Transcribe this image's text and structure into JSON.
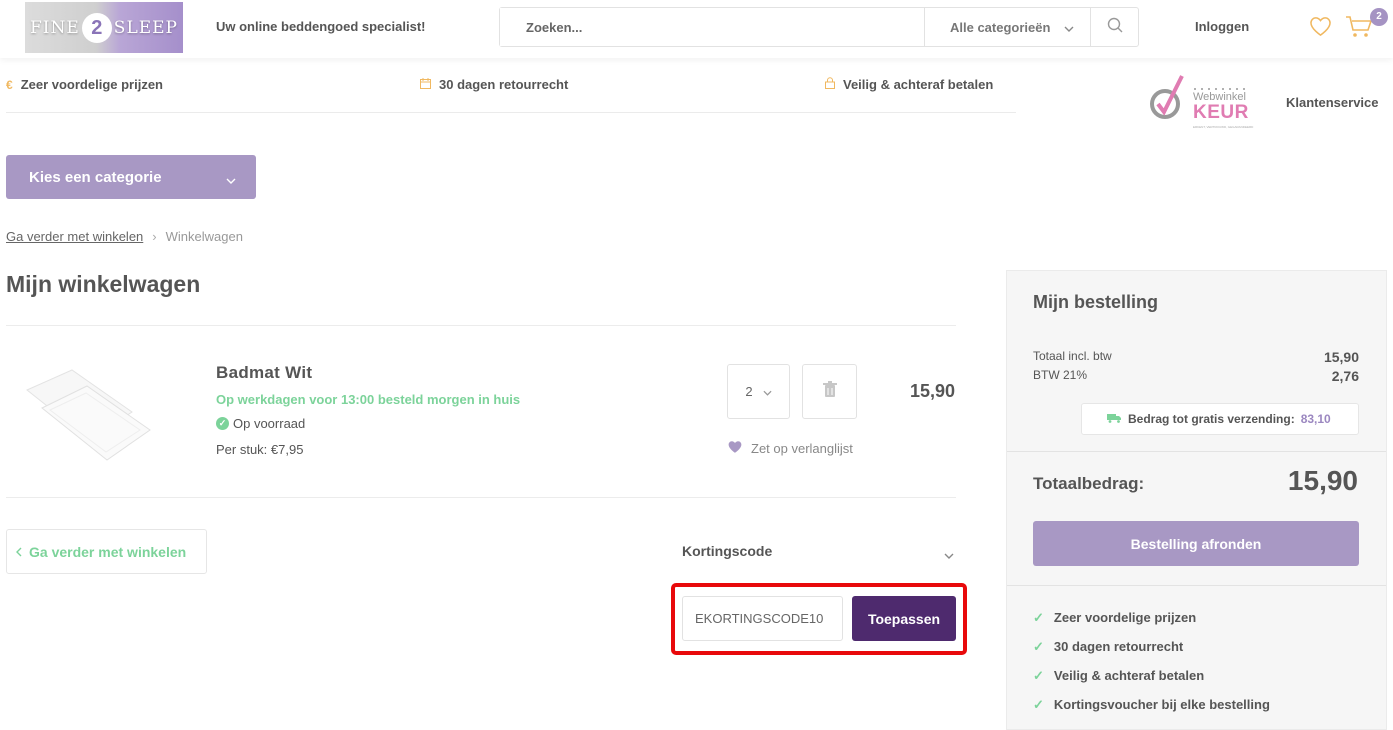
{
  "header": {
    "logo_left": "FINE",
    "logo_mid": "2",
    "logo_right": "SLEEP",
    "tagline": "Uw online beddengoed specialist!",
    "search_placeholder": "Zoeken...",
    "category_select": "Alle categorieën",
    "login": "Inloggen",
    "cart_count": "2"
  },
  "usps": [
    {
      "icon": "euro-icon",
      "label": "Zeer voordelige prijzen"
    },
    {
      "icon": "calendar-icon",
      "label": "30 dagen retourrecht"
    },
    {
      "icon": "lock-icon",
      "label": "Veilig & achteraf betalen"
    }
  ],
  "keur": {
    "top": "Webwinkel",
    "main": "KEUR",
    "sub": "ERKENT, VERTROUWD, GEGARANDEERD"
  },
  "klantenservice": "Klantenservice",
  "category_button": "Kies een categorie",
  "breadcrumb": {
    "link": "Ga verder met winkelen",
    "current": "Winkelwagen"
  },
  "page_title": "Mijn winkelwagen",
  "product": {
    "name": "Badmat Wit",
    "delivery": "Op werkdagen voor 13:00 besteld morgen in huis",
    "stock": "Op voorraad",
    "unit_price": "Per stuk: €7,95",
    "quantity": "2",
    "price": "15,90",
    "wishlist": "Zet op verlanglijst"
  },
  "continue_button": "Ga verder met winkelen",
  "discount": {
    "label": "Kortingscode",
    "value": "EKORTINGSCODE10",
    "apply": "Toepassen"
  },
  "summary": {
    "title": "Mijn bestelling",
    "total_incl_label": "Totaal incl. btw",
    "total_incl_value": "15,90",
    "btw_label": "BTW 21%",
    "btw_value": "2,76",
    "shipping_label": "Bedrag tot gratis verzending:",
    "shipping_value": "83,10",
    "grand_label": "Totaalbedrag:",
    "grand_value": "15,90",
    "checkout": "Bestelling afronden",
    "usps": [
      "Zeer voordelige prijzen",
      "30 dagen retourrecht",
      "Veilig & achteraf betalen",
      "Kortingsvoucher bij elke bestelling"
    ]
  },
  "colors": {
    "accent": "#a898c4",
    "dark_purple": "#4e2a6e",
    "green": "#7cd39a",
    "highlight": "#e8090b"
  }
}
